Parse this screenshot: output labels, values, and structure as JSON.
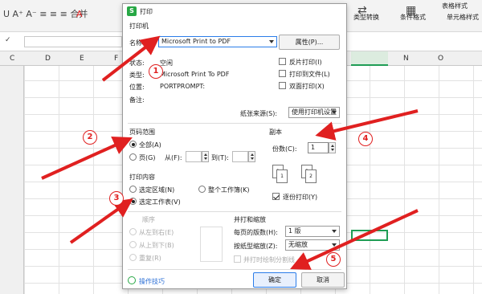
{
  "ribbon": {
    "font_controls": "U  A⁺ A⁻  ≡ ≡ ≡  合并",
    "type_convert": "类型转换",
    "cond_format": "条件格式",
    "table_style": "表格样式",
    "cell_style": "单元格样式"
  },
  "columns": [
    "C",
    "D",
    "E",
    "F",
    "G",
    "H",
    "I",
    "J",
    "K",
    "L",
    "M",
    "N",
    "O"
  ],
  "dialog": {
    "title": "打印",
    "printer_section": "打印机",
    "name_label": "名称(M):",
    "printer_name": "Microsoft Print to PDF",
    "properties_btn": "属性(P)...",
    "status_label": "状态:",
    "status_value": "空闲",
    "type_label": "类型:",
    "type_value": "Microsoft Print To PDF",
    "location_label": "位置:",
    "location_value": "PORTPROMPT:",
    "comment_label": "备注:",
    "reverse_print": "反片打印(I)",
    "print_to_file": "打印到文件(L)",
    "duplex": "双面打印(X)",
    "paper_source_label": "纸张来源(S):",
    "paper_source_value": "使用打印机设置",
    "page_range_title": "页码范围",
    "all": "全部(A)",
    "pages": "页(G)",
    "from": "从(F):",
    "to": "到(T):",
    "copies_title": "副本",
    "copies_label": "份数(C):",
    "copies_value": "1",
    "collate": "逐份打印(Y)",
    "print_content_title": "打印内容",
    "selection": "选定区域(N)",
    "whole_workbook": "整个工作簿(K)",
    "selected_sheet": "选定工作表(V)",
    "order_title": "顺序",
    "left_to_right": "从左到右(E)",
    "top_to_bottom": "从上到下(B)",
    "repeat": "重复(R)",
    "scale_title": "并打和缩放",
    "pages_per_sheet_label": "每页的版数(H):",
    "pages_per_sheet_value": "1 版",
    "scale_label": "按纸型缩放(Z):",
    "scale_value": "无缩放",
    "draw_borders": "并打时绘制分割线",
    "tips": "操作技巧",
    "ok": "确定",
    "cancel": "取消"
  },
  "annotations": [
    "1",
    "2",
    "3",
    "4",
    "5"
  ],
  "colors": {
    "accent": "#1f9d55",
    "arrow": "#e02020",
    "wps": "#27a845"
  }
}
